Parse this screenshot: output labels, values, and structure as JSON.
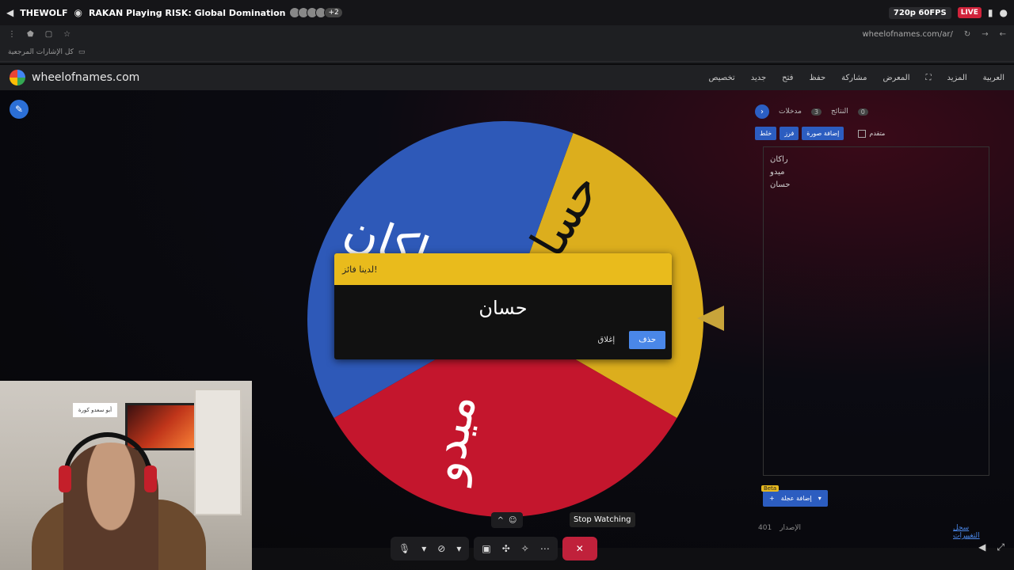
{
  "stream": {
    "channel": "THEWOLF",
    "title": "RAKAN Playing RISK: Global Domination",
    "extra_viewers": "+2",
    "quality": "720p 60FPS",
    "live": "LIVE"
  },
  "browser": {
    "url": "wheelofnames.com/ar/",
    "bookmarks_label": "كل الإشارات المرجعية"
  },
  "app": {
    "site_name": "wheelofnames.com",
    "menu": [
      "تخصيص",
      "جديد",
      "فتح",
      "حفظ",
      "مشاركة",
      "المعرض",
      "المزيد",
      "العربية"
    ]
  },
  "wheel": {
    "segments": [
      {
        "label": "حسان",
        "color": "#dcae1d"
      },
      {
        "label": "ميدو",
        "color": "#c4162d"
      },
      {
        "label": "راكان",
        "color": "#2e59b8"
      }
    ]
  },
  "dialog": {
    "header": "لدينا فائز!",
    "winner": "حسان",
    "close_label": "إغلاق",
    "remove_label": "حذف"
  },
  "panel": {
    "tab_entries": "مدخلات",
    "entries_count": "3",
    "tab_results": "النتائج",
    "results_count": "0",
    "tools": [
      "خلط",
      "فرز",
      "إضافة صورة"
    ],
    "advanced_label": "متقدم",
    "entries": [
      "راكان",
      "ميدو",
      "حسان"
    ],
    "add_wheel_label": "إضافة عجلة",
    "beta": "Beta",
    "version_label": "الإصدار",
    "version": "401",
    "history_label": "سجل التغييرات"
  },
  "webcam": {
    "sign_text": "أبو سعدو كورة"
  },
  "call": {
    "tooltip": "Stop Watching"
  }
}
